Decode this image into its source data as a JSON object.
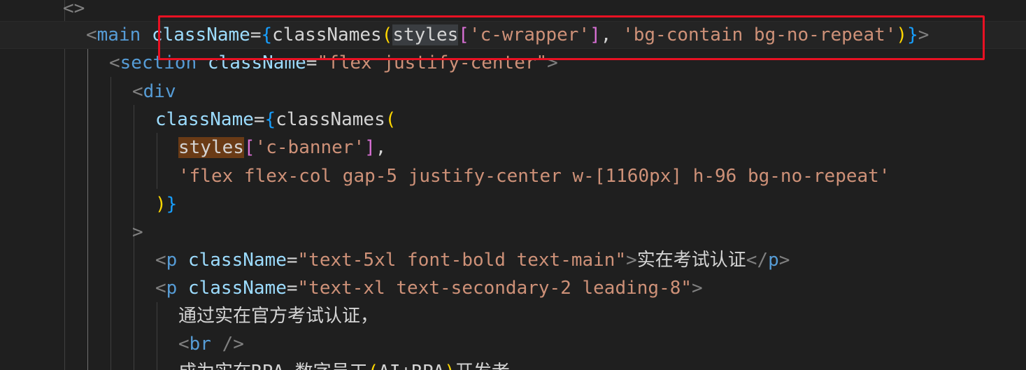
{
  "editor": {
    "lines": [
      {
        "id": "l1",
        "tokens": [
          {
            "t": "<>",
            "c": "tag-bracket"
          }
        ]
      },
      {
        "id": "l2",
        "tokens": [
          {
            "t": "<",
            "c": "tag-bracket"
          },
          {
            "t": "main",
            "c": "tag"
          },
          {
            "t": " "
          },
          {
            "t": "className",
            "c": "attr"
          },
          {
            "t": "=",
            "c": "op"
          },
          {
            "t": "{",
            "c": "brace"
          },
          {
            "t": "classNames",
            "c": "ident"
          },
          {
            "t": "(",
            "c": "paren"
          },
          {
            "t": "styles",
            "c": "ident hl-word"
          },
          {
            "t": "[",
            "c": "sq"
          },
          {
            "t": "'c-wrapper'",
            "c": "str"
          },
          {
            "t": "]",
            "c": "sq"
          },
          {
            "t": ", ",
            "c": "op"
          },
          {
            "t": "'bg-contain bg-no-repeat'",
            "c": "str"
          },
          {
            "t": ")",
            "c": "paren"
          },
          {
            "t": "}",
            "c": "brace"
          },
          {
            "t": ">",
            "c": "tag-bracket"
          }
        ]
      },
      {
        "id": "l3",
        "tokens": [
          {
            "t": "<",
            "c": "tag-bracket"
          },
          {
            "t": "section",
            "c": "tag"
          },
          {
            "t": " "
          },
          {
            "t": "className",
            "c": "attr"
          },
          {
            "t": "=",
            "c": "op"
          },
          {
            "t": "\"flex justify-center\"",
            "c": "str"
          },
          {
            "t": ">",
            "c": "tag-bracket"
          }
        ]
      },
      {
        "id": "l4",
        "tokens": [
          {
            "t": "<",
            "c": "tag-bracket"
          },
          {
            "t": "div",
            "c": "tag"
          }
        ]
      },
      {
        "id": "l5",
        "tokens": [
          {
            "t": "className",
            "c": "attr"
          },
          {
            "t": "=",
            "c": "op"
          },
          {
            "t": "{",
            "c": "brace"
          },
          {
            "t": "classNames",
            "c": "ident"
          },
          {
            "t": "(",
            "c": "paren"
          }
        ]
      },
      {
        "id": "l6",
        "tokens": [
          {
            "t": "styles",
            "c": "ident hl-ref"
          },
          {
            "t": "[",
            "c": "sq"
          },
          {
            "t": "'c-banner'",
            "c": "str"
          },
          {
            "t": "]",
            "c": "sq"
          },
          {
            "t": ",",
            "c": "op"
          }
        ]
      },
      {
        "id": "l7",
        "tokens": [
          {
            "t": "'flex flex-col gap-5 justify-center w-[1160px] h-96 bg-no-repeat'",
            "c": "str"
          }
        ]
      },
      {
        "id": "l8",
        "tokens": [
          {
            "t": ")",
            "c": "paren"
          },
          {
            "t": "}",
            "c": "brace"
          }
        ]
      },
      {
        "id": "l9",
        "tokens": [
          {
            "t": ">",
            "c": "tag-bracket"
          }
        ]
      },
      {
        "id": "l10",
        "tokens": []
      },
      {
        "id": "l11",
        "tokens": [
          {
            "t": "<",
            "c": "tag-bracket"
          },
          {
            "t": "p",
            "c": "tag"
          },
          {
            "t": " "
          },
          {
            "t": "className",
            "c": "attr"
          },
          {
            "t": "=",
            "c": "op"
          },
          {
            "t": "\"text-5xl font-bold text-main\"",
            "c": "str"
          },
          {
            "t": ">",
            "c": "tag-bracket"
          },
          {
            "t": "实在考试认证",
            "c": "text"
          },
          {
            "t": "</",
            "c": "tag-bracket"
          },
          {
            "t": "p",
            "c": "tag"
          },
          {
            "t": ">",
            "c": "tag-bracket"
          }
        ]
      },
      {
        "id": "l12",
        "tokens": [
          {
            "t": "<",
            "c": "tag-bracket"
          },
          {
            "t": "p",
            "c": "tag"
          },
          {
            "t": " "
          },
          {
            "t": "className",
            "c": "attr"
          },
          {
            "t": "=",
            "c": "op"
          },
          {
            "t": "\"text-xl text-secondary-2 leading-8\"",
            "c": "str"
          },
          {
            "t": ">",
            "c": "tag-bracket"
          }
        ]
      },
      {
        "id": "l13",
        "tokens": [
          {
            "t": "通过实在官方考试认证，",
            "c": "text"
          }
        ]
      },
      {
        "id": "l14",
        "tokens": [
          {
            "t": "<",
            "c": "tag-bracket"
          },
          {
            "t": "br",
            "c": "tag"
          },
          {
            "t": " "
          },
          {
            "t": "/>",
            "c": "tag-bracket"
          }
        ]
      },
      {
        "id": "l15",
        "tokens": [
          {
            "t": "成为实在RPA 数字员工",
            "c": "text"
          },
          {
            "t": "(",
            "c": "paren"
          },
          {
            "t": "AI+RPA",
            "c": "text"
          },
          {
            "t": ")",
            "c": "paren"
          },
          {
            "t": "开发者",
            "c": "text"
          }
        ]
      }
    ]
  },
  "colors": {
    "background": "#1f1f1f",
    "selection_border": "#e81123"
  }
}
